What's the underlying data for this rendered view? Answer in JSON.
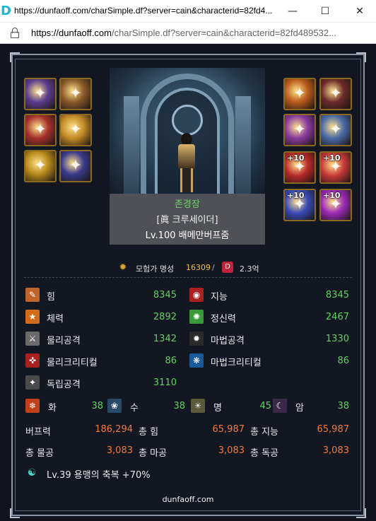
{
  "window": {
    "title": "https://dunfaoff.com/charSimple.df?server=cain&characterid=82fd4...",
    "favicon": "D",
    "minimize_icon": "minimize-icon",
    "maximize_icon": "maximize-icon",
    "close_icon": "close-icon"
  },
  "address_bar": {
    "url_host": "https://dunfaoff.com",
    "url_path": "/charSimple.df?server=cain&characterid=82fd489532..."
  },
  "equipment_left": [
    {
      "name": "item-slot-1",
      "enhance": "",
      "color": "#5b3c8e"
    },
    {
      "name": "item-slot-2",
      "enhance": "",
      "color": "#8a5a2a"
    },
    {
      "name": "item-slot-3",
      "enhance": "",
      "color": "#a4302c"
    },
    {
      "name": "item-slot-4",
      "enhance": "",
      "color": "#c48a28"
    },
    {
      "name": "item-slot-5",
      "enhance": "",
      "color": "#b88a1c"
    },
    {
      "name": "item-slot-6",
      "enhance": "",
      "color": "#3a3a8e"
    }
  ],
  "equipment_right": [
    {
      "name": "item-slot-7",
      "enhance": "",
      "color": "#b85a1c"
    },
    {
      "name": "item-slot-8",
      "enhance": "",
      "color": "#6a2a2a"
    },
    {
      "name": "item-slot-9",
      "enhance": "",
      "color": "#8a3a9e"
    },
    {
      "name": "item-slot-10",
      "enhance": "",
      "color": "#4a6aa8"
    },
    {
      "name": "item-slot-11",
      "enhance": "+10",
      "color": "#b82a2a"
    },
    {
      "name": "item-slot-12",
      "enhance": "+10",
      "color": "#c83a3a"
    },
    {
      "name": "item-slot-13",
      "enhance": "+10",
      "color": "#3a4ab8"
    },
    {
      "name": "item-slot-14",
      "enhance": "+10",
      "color": "#9a2ab8"
    }
  ],
  "character": {
    "name": "존경장",
    "job": "[眞 크루세이더]",
    "level": "Lv.100 배메만버프줌"
  },
  "fame": {
    "label": "모험가 명성",
    "value": "16309",
    "separator": "/",
    "badge": "D",
    "damage": "2.3억"
  },
  "stats": [
    {
      "label": "힘",
      "value": "8345",
      "icon": "strength-icon",
      "color": "#c0652a"
    },
    {
      "label": "지능",
      "value": "8345",
      "icon": "intelligence-icon",
      "color": "#a82020"
    },
    {
      "label": "체력",
      "value": "2892",
      "icon": "vitality-icon",
      "color": "#d26a1a"
    },
    {
      "label": "정신력",
      "value": "2467",
      "icon": "spirit-icon",
      "color": "#3a9a3a"
    },
    {
      "label": "물리공격",
      "value": "1342",
      "icon": "physical-attack-icon",
      "color": "#6a6a6a"
    },
    {
      "label": "마법공격",
      "value": "1330",
      "icon": "magic-attack-icon",
      "color": "#2a2a2a"
    },
    {
      "label": "물리크리티컬",
      "value": "86",
      "icon": "physical-critical-icon",
      "color": "#a82020"
    },
    {
      "label": "마법크리티컬",
      "value": "86",
      "icon": "magic-critical-icon",
      "color": "#1a5a9a"
    },
    {
      "label": "독립공격",
      "value": "3110",
      "icon": "independent-attack-icon",
      "color": "#4a4a4a"
    }
  ],
  "elements": [
    {
      "label": "화",
      "value": "38",
      "icon": "fire-element-icon",
      "color": "#c0401a"
    },
    {
      "label": "수",
      "value": "38",
      "icon": "water-element-icon",
      "color": "#2a4a6a"
    },
    {
      "label": "명",
      "value": "45",
      "icon": "light-element-icon",
      "color": "#5a5a3a"
    },
    {
      "label": "암",
      "value": "38",
      "icon": "dark-element-icon",
      "color": "#3a2a4a"
    }
  ],
  "summary": {
    "row1": [
      {
        "label": "버프력",
        "value": "186,294"
      },
      {
        "label": "총 힘",
        "value": "65,987"
      },
      {
        "label": "총 지능",
        "value": "65,987"
      }
    ],
    "row2": [
      {
        "label": "총 물공",
        "value": "3,083"
      },
      {
        "label": "총 마공",
        "value": "3,083"
      },
      {
        "label": "총 독공",
        "value": "3,083"
      }
    ]
  },
  "buff": {
    "text": "Lv.39 용맹의 축복 +70%",
    "icon": "blessing-icon"
  },
  "footer": "dunfaoff.com"
}
